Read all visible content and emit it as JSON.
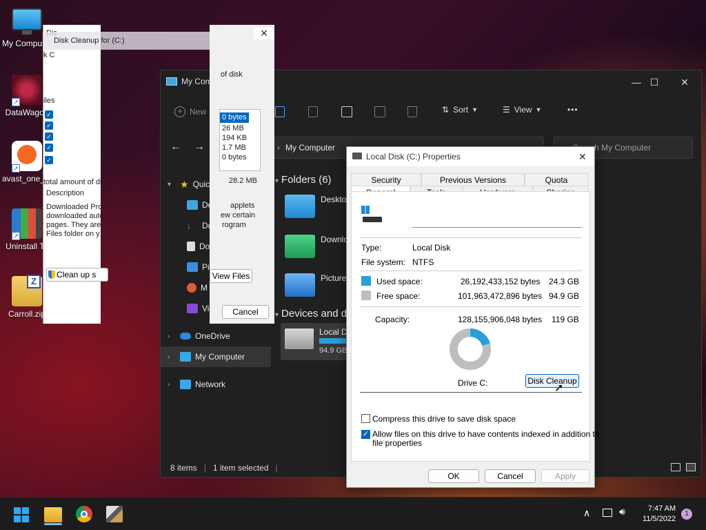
{
  "desktop": {
    "icons": [
      {
        "label": "My Computer"
      },
      {
        "label": "DataWagon"
      },
      {
        "label": "avast_one_fo"
      },
      {
        "label": "Uninstall To"
      },
      {
        "label": "Carroll.zip"
      }
    ]
  },
  "disk_cleanup": {
    "title": "Disk Cleanup for  (C:)",
    "title_frag": "Dis",
    "frag_c": "k C",
    "frag_iles": "iles",
    "frag_total": "total amount of dis",
    "desc_label": "Description",
    "desc_lines": [
      "Downloaded Pro",
      "downloaded auto",
      "pages. They are",
      "Files folder on y"
    ],
    "cleanup_btn": "Clean up s",
    "of_disk": "of disk",
    "sizes": [
      "0 bytes",
      "26 MB",
      "194 KB",
      "1.7 MB",
      "0 bytes"
    ],
    "total": "28.2 MB",
    "right_lines": [
      "applets",
      "ew certain",
      "rogram"
    ],
    "view_files": "View Files",
    "cancel": "Cancel",
    "close_glyph": "✕"
  },
  "explorer": {
    "title": "My Compu",
    "toolbar": {
      "new": "New",
      "sort": "Sort",
      "view": "View",
      "more": "•••"
    },
    "address": "My Computer",
    "search_placeholder": "Search My Computer",
    "nav": [
      {
        "label": "Quick a"
      },
      {
        "label": "Deskt"
      },
      {
        "label": "Down"
      },
      {
        "label": "Docu"
      },
      {
        "label": "Pi"
      },
      {
        "label": "M"
      },
      {
        "label": "Vi"
      },
      {
        "label": "OneDrive"
      },
      {
        "label": "My Computer"
      },
      {
        "label": "Network"
      }
    ],
    "folders_heading": "Folders (6)",
    "folders": [
      "Desktop",
      "Downlo",
      "Pictures"
    ],
    "devices_heading": "Devices and d",
    "drive_name": "Local D",
    "drive_free": "94.9 GB",
    "status_items": "8 items",
    "status_selected": "1 item selected",
    "colors": {
      "accent": "#0078d4",
      "bg": "#202020"
    }
  },
  "properties": {
    "title": "Local Disk (C:) Properties",
    "tabs_top": [
      "Security",
      "Previous Versions",
      "Quota"
    ],
    "tabs_bottom": [
      "General",
      "Tools",
      "Hardware",
      "Sharing"
    ],
    "type_label": "Type:",
    "type_value": "Local Disk",
    "fs_label": "File system:",
    "fs_value": "NTFS",
    "used_label": "Used space:",
    "used_bytes": "26,192,433,152 bytes",
    "used_gb": "24.3 GB",
    "free_label": "Free space:",
    "free_bytes": "101,963,472,896 bytes",
    "free_gb": "94.9 GB",
    "capacity_label": "Capacity:",
    "capacity_bytes": "128,155,906,048 bytes",
    "capacity_gb": "119 GB",
    "drive_label": "Drive C:",
    "disk_cleanup_btn": "Disk Cleanup",
    "compress_label": "Compress this drive to save disk space",
    "index_label_1": "Allow files on this drive to have contents indexed in addition to",
    "index_label_2": "file properties",
    "ok": "OK",
    "cancel": "Cancel",
    "apply": "Apply",
    "used_fraction": 0.204,
    "colors": {
      "used": "#26a0da",
      "free": "#bebebe"
    }
  },
  "taskbar": {
    "time": "7:47 AM",
    "date": "11/5/2022",
    "notification_count": "1"
  }
}
